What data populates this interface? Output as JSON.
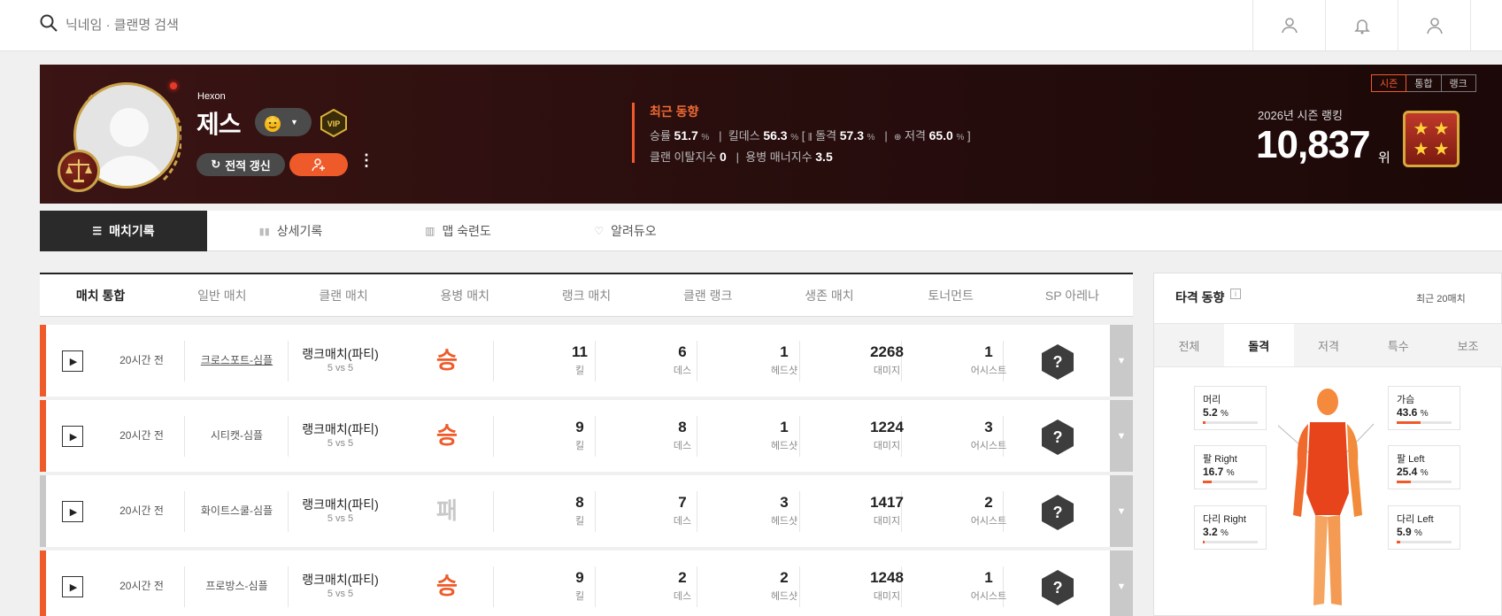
{
  "search": {
    "placeholder": "닉네임 · 클랜명 검색"
  },
  "profile": {
    "clan_name": "Hexon",
    "nickname": "제스",
    "refresh_label": "전적 갱신",
    "more_label": "⋮"
  },
  "trend": {
    "title": "최근 동향",
    "win_label": "승률",
    "win_value": "51.7",
    "win_unit": "%",
    "kd_label": "킬데스",
    "kd_value": "56.3",
    "kd_unit": "%",
    "assault_label": "돌격",
    "assault_value": "57.3",
    "assault_unit": "%",
    "sniper_label": "저격",
    "sniper_value": "65.0",
    "sniper_unit": "%",
    "bracket_open": "[",
    "bracket_close": "]",
    "clan_leave_label": "클랜 이탈지수",
    "clan_leave_value": "0",
    "merc_label": "용병 매너지수",
    "merc_value": "3.5"
  },
  "season_tabs": [
    "시즌",
    "통합",
    "랭크"
  ],
  "ranking": {
    "label": "2026년 시즌 랭킹",
    "value": "10,837",
    "unit": "위"
  },
  "main_tabs": [
    "매치기록",
    "상세기록",
    "맵 숙련도",
    "알려듀오"
  ],
  "match_filters": [
    "매치 통합",
    "일반 매치",
    "클랜 매치",
    "용병 매치",
    "랭크 매치",
    "클랜 랭크",
    "생존 매치",
    "토너먼트",
    "SP 아레나"
  ],
  "stat_labels": {
    "kill": "킬",
    "death": "데스",
    "headshot": "헤드샷",
    "damage": "대미지",
    "assist": "어시스트"
  },
  "matches": [
    {
      "time": "20시간 전",
      "map": "크로스포트-심플",
      "mode": "랭크매치(파티)",
      "team": "5 vs 5",
      "result": "승",
      "kill": "11",
      "death": "6",
      "headshot": "1",
      "damage": "2268",
      "assist": "1",
      "hex": "?"
    },
    {
      "time": "20시간 전",
      "map": "시티캣-심플",
      "mode": "랭크매치(파티)",
      "team": "5 vs 5",
      "result": "승",
      "kill": "9",
      "death": "8",
      "headshot": "1",
      "damage": "1224",
      "assist": "3",
      "hex": "?"
    },
    {
      "time": "20시간 전",
      "map": "화이트스쿨-심플",
      "mode": "랭크매치(파티)",
      "team": "5 vs 5",
      "result": "패",
      "kill": "8",
      "death": "7",
      "headshot": "3",
      "damage": "1417",
      "assist": "2",
      "hex": "?"
    },
    {
      "time": "20시간 전",
      "map": "프로방스-심플",
      "mode": "랭크매치(파티)",
      "team": "5 vs 5",
      "result": "승",
      "kill": "9",
      "death": "2",
      "headshot": "2",
      "damage": "1248",
      "assist": "1",
      "hex": "?"
    }
  ],
  "hit_panel": {
    "title": "타격 동향",
    "info": "i",
    "recent": "최근 20매치",
    "tabs": [
      "전체",
      "돌격",
      "저격",
      "특수",
      "보조"
    ],
    "parts": {
      "head": {
        "label": "머리",
        "value": "5.2",
        "unit": "%",
        "fraction": 0.052
      },
      "chest": {
        "label": "가슴",
        "value": "43.6",
        "unit": "%",
        "fraction": 0.436
      },
      "arm_right": {
        "label": "팔 Right",
        "value": "16.7",
        "unit": "%",
        "fraction": 0.167
      },
      "arm_left": {
        "label": "팔 Left",
        "value": "25.4",
        "unit": "%",
        "fraction": 0.254
      },
      "leg_right": {
        "label": "다리 Right",
        "value": "3.2",
        "unit": "%",
        "fraction": 0.032
      },
      "leg_left": {
        "label": "다리 Left",
        "value": "5.9",
        "unit": "%",
        "fraction": 0.059
      }
    }
  },
  "colors": {
    "accent": "#ef5a2a",
    "win": "#ef5a2a",
    "loss": "#c8c8c8",
    "banner": "#2a0e0e"
  }
}
